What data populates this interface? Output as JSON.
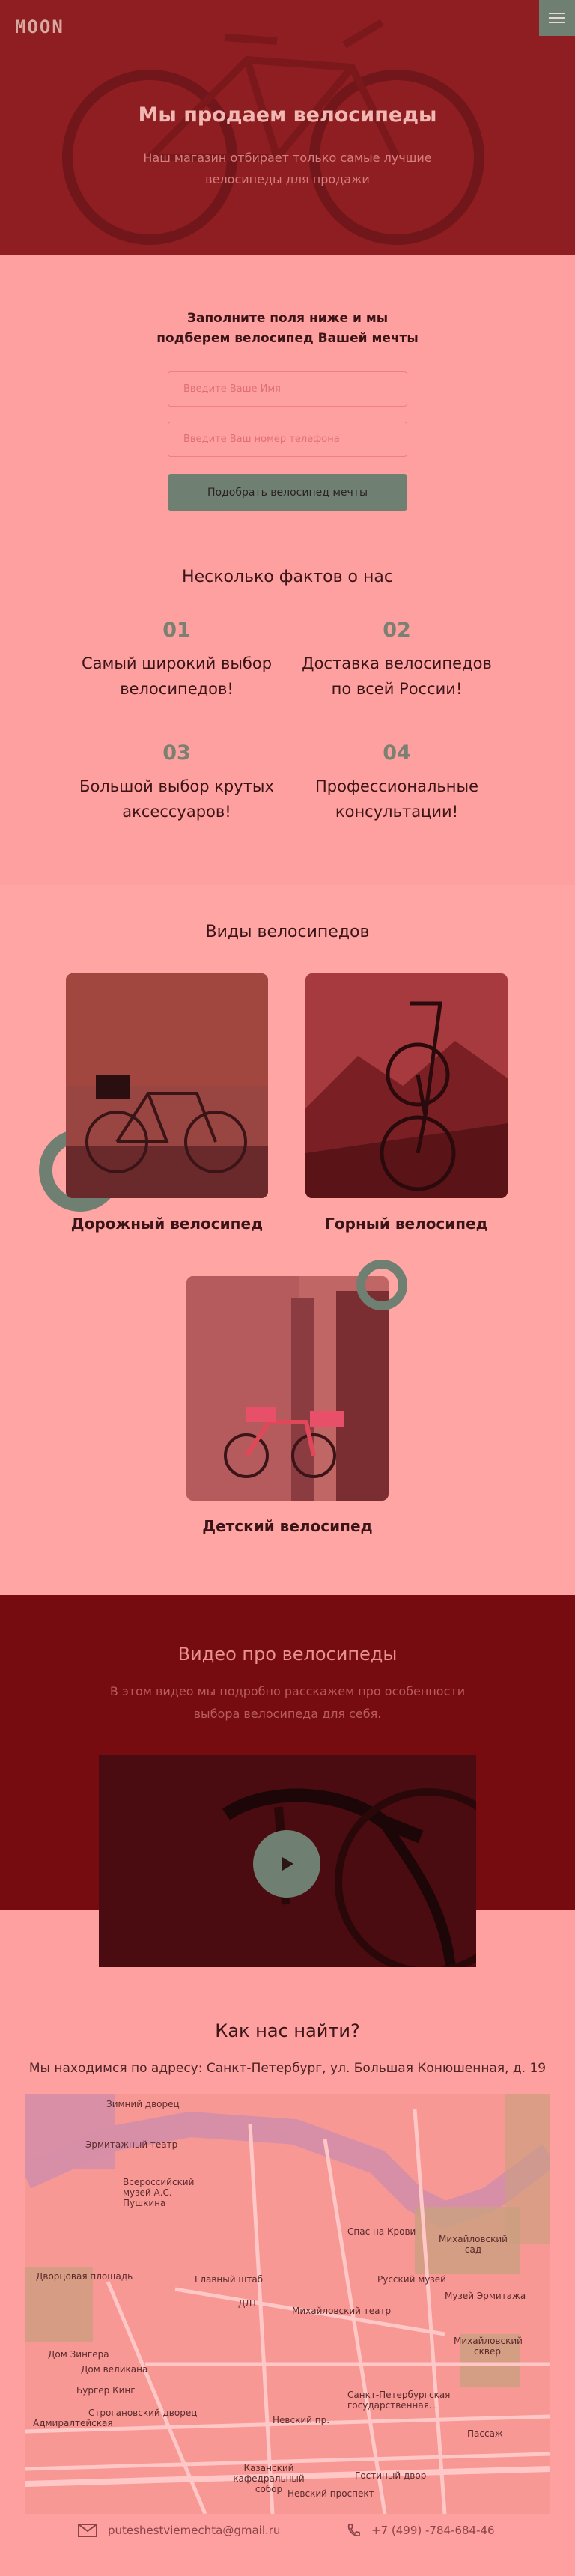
{
  "header": {
    "logo": "MOON",
    "menu_icon": "hamburger-icon",
    "title": "Мы продаем велосипеды",
    "subtitle_line1": "Наш магазин отбирает только самые лучшие",
    "subtitle_line2": "велосипеды для продажи"
  },
  "form": {
    "title_line1": "Заполните поля ниже и мы",
    "title_line2": "подберем велосипед Вашей мечты",
    "name_placeholder": "Введите Ваше Имя",
    "phone_placeholder": "Введите Ваш номер телефона",
    "submit_label": "Подобрать велосипед мечты"
  },
  "facts": {
    "title": "Несколько фактов о нас",
    "items": [
      {
        "num": "01",
        "line1": "Самый широкий выбор",
        "line2": "велосипедов!"
      },
      {
        "num": "02",
        "line1": "Доставка велосипедов",
        "line2": "по всей России!"
      },
      {
        "num": "03",
        "line1": "Большой выбор крутых",
        "line2": "аксессуаров!"
      },
      {
        "num": "04",
        "line1": "Профессиональные",
        "line2": "консультации!"
      }
    ]
  },
  "types": {
    "title": "Виды велосипедов",
    "items": [
      {
        "label": "Дорожный велосипед"
      },
      {
        "label": "Горный велосипед"
      },
      {
        "label": "Детский велосипед"
      }
    ]
  },
  "video": {
    "title": "Видео про велосипеды",
    "subtitle_line1": "В этом видео мы подробно расскажем про особенности",
    "subtitle_line2": "выбора велосипеда для себя.",
    "play_icon": "play-icon"
  },
  "location": {
    "title": "Как нас найти?",
    "address": "Мы находимся по адресу: Санкт-Петербург, ул. Большая Конюшенная, д. 19",
    "map_labels": {
      "m1": "Зимний дворец",
      "m2": "Эрмитажный театр",
      "m3": "Всероссийский музей А.С. Пушкина",
      "m4": "Спас на Крови",
      "m5": "Михайловский сад",
      "m6": "Главный штаб",
      "m7": "Русский музей",
      "m8": "Михайловский театр",
      "m9": "ДЛТ",
      "m10": "Михайловский сквер",
      "m11": "Дом Зингера",
      "m12": "Бургер Кинг",
      "m13": "Санкт-Петербургская государственная...",
      "m14": "Строгановский дворец",
      "m15": "Адмиралтейская",
      "m16": "Невский пр.",
      "m17": "Пассаж",
      "m18": "Казанский кафедральный собор",
      "m19": "Гостиный двор",
      "m20": "Невский проспект",
      "m21": "Музей Эрмитажа",
      "m22": "Дворцовая площадь",
      "m23": "Дом великана"
    }
  },
  "contacts": {
    "email": "puteshestviemechta@gmail.ru",
    "email_icon": "mail-icon",
    "phone": "+7 (499) -784-684-46",
    "phone_icon": "phone-icon"
  }
}
